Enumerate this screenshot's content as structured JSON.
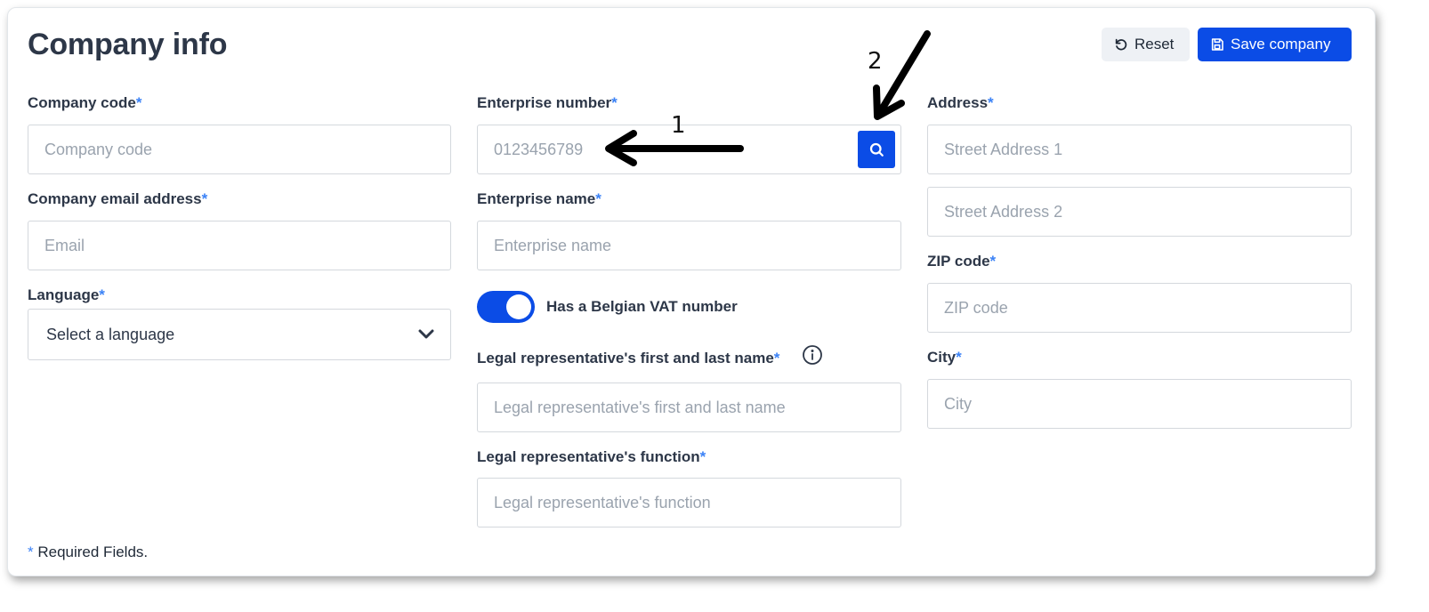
{
  "header": {
    "title": "Company info",
    "reset_label": "Reset",
    "save_label": "Save company"
  },
  "required_marker": "*",
  "column_left": {
    "company_code": {
      "label": "Company code",
      "placeholder": "Company code"
    },
    "email": {
      "label": "Company email address",
      "placeholder": "Email"
    },
    "language": {
      "label": "Language",
      "selected": "Select a language"
    }
  },
  "column_middle": {
    "enterprise_number": {
      "label": "Enterprise number",
      "placeholder": "0123456789"
    },
    "enterprise_name": {
      "label": "Enterprise name",
      "placeholder": "Enterprise name"
    },
    "vat_toggle": {
      "label": "Has a Belgian VAT number",
      "on": true
    },
    "legal_rep_name": {
      "label": "Legal representative's first and last name",
      "placeholder": "Legal representative's first and last name"
    },
    "legal_rep_function": {
      "label": "Legal representative's function",
      "placeholder": "Legal representative's function"
    }
  },
  "column_right": {
    "address": {
      "label": "Address",
      "placeholder_1": "Street Address 1",
      "placeholder_2": "Street Address 2"
    },
    "zip": {
      "label": "ZIP code",
      "placeholder": "ZIP code"
    },
    "city": {
      "label": "City",
      "placeholder": "City"
    }
  },
  "footnote": {
    "marker": "*",
    "text": " Required Fields."
  },
  "annotations": {
    "first": "1",
    "second": "2"
  },
  "colors": {
    "accent": "#0b4ce6",
    "required": "#3b82f6",
    "text": "#2d3748",
    "placeholder": "#9aa3ae"
  }
}
